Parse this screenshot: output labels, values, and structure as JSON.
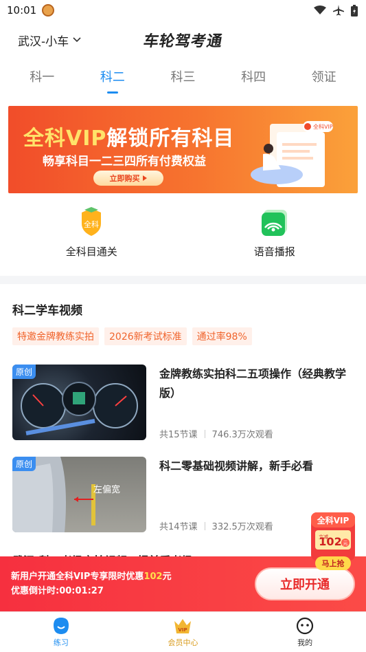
{
  "status_bar": {
    "time": "10:01"
  },
  "header": {
    "city": "武汉-小车",
    "brand": "车轮驾考通"
  },
  "tabs": [
    {
      "label": "科一"
    },
    {
      "label": "科二",
      "active": true
    },
    {
      "label": "科三"
    },
    {
      "label": "科四"
    },
    {
      "label": "领证"
    }
  ],
  "banner": {
    "title_highlight": "全科VIP",
    "title_rest": "解锁所有科目",
    "subtitle": "畅享科目一二三四所有付费权益",
    "button": "立即购买",
    "art_badge": "全科VIP"
  },
  "features": [
    {
      "label": "全科目通关",
      "icon": "badge-icon",
      "icon_text": "全科"
    },
    {
      "label": "语音播报",
      "icon": "broadcast-icon"
    }
  ],
  "video_section": {
    "title": "科二学车视频",
    "tags": [
      "特邀金牌教练实拍",
      "2026新考试标准",
      "通过率98%"
    ],
    "videos": [
      {
        "badge": "原创",
        "title": "金牌教练实拍科二五项操作（经典教学版）",
        "lessons": "共15节课",
        "views": "746.3万次观看"
      },
      {
        "badge": "原创",
        "title": "科二零基础视频讲解，新手必看",
        "lessons": "共14节课",
        "views": "332.5万次观看",
        "thumb_label": "左偏宽"
      }
    ],
    "partial_next_title": "武汉-科二考场实拍视频，提前看考场"
  },
  "float_vip": {
    "line1": "全科VIP",
    "line2": "立减",
    "amount": "102",
    "unit": "元",
    "cta": "马上抢"
  },
  "promo": {
    "text_prefix": "新用户开通全科VIP专享限时优惠",
    "amount": "102",
    "text_suffix": "元",
    "countdown_label": "优惠倒计时:",
    "countdown": "00:01:27",
    "button": "立即开通"
  },
  "bottom_nav": [
    {
      "label": "练习",
      "active": true
    },
    {
      "label": "会员中心"
    },
    {
      "label": "我的"
    }
  ],
  "colors": {
    "accent": "#1c8cf0",
    "promo": "#f6303f",
    "tag": "#f0642c"
  }
}
